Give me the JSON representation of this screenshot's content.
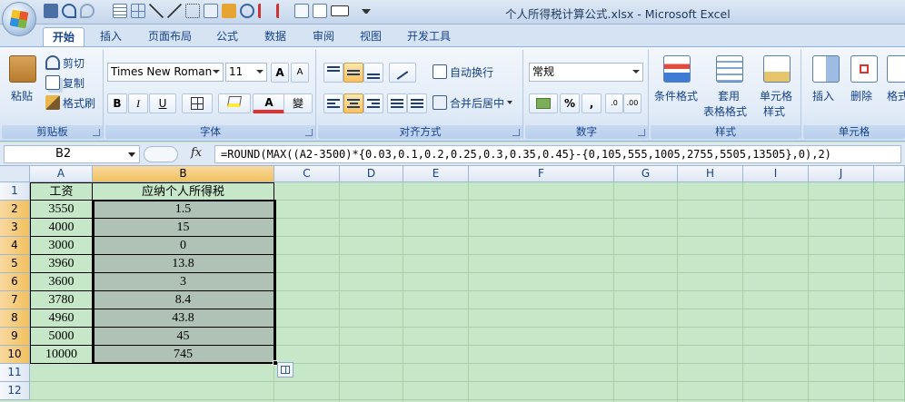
{
  "window": {
    "title": "个人所得税计算公式.xlsx - Microsoft Excel"
  },
  "tabs": [
    "开始",
    "插入",
    "页面布局",
    "公式",
    "数据",
    "审阅",
    "视图",
    "开发工具"
  ],
  "ribbon": {
    "clipboard": {
      "label": "剪贴板",
      "paste": "粘贴",
      "cut": "剪切",
      "copy": "复制",
      "format_painter": "格式刷"
    },
    "font": {
      "label": "字体",
      "name": "Times New Roman",
      "size": "11",
      "bold": "B",
      "italic": "I",
      "underline": "U",
      "wen": "變"
    },
    "alignment": {
      "label": "对齐方式",
      "wrap": "自动换行",
      "merge": "合并后居中"
    },
    "number": {
      "label": "数字",
      "format": "常规",
      "percent": "%",
      "comma": ","
    },
    "styles": {
      "label": "样式",
      "conditional": "条件格式",
      "table_line1": "套用",
      "table_line2": "表格格式",
      "cell_line1": "单元格",
      "cell_line2": "样式"
    },
    "cells": {
      "label": "单元格",
      "insert": "插入",
      "delete": "删除",
      "format": "格式"
    }
  },
  "formula_bar": {
    "name_box": "B2",
    "fx": "fx",
    "formula": "=ROUND(MAX((A2-3500)*{0.03,0.1,0.2,0.25,0.3,0.35,0.45}-{0,105,555,1005,2755,5505,13505},0),2)"
  },
  "sheet": {
    "columns": [
      "A",
      "B",
      "C",
      "D",
      "E",
      "F",
      "G",
      "H",
      "I",
      "J"
    ],
    "rows": [
      "1",
      "2",
      "3",
      "4",
      "5",
      "6",
      "7",
      "8",
      "9",
      "10",
      "11",
      "12"
    ],
    "header": [
      "工资",
      "应纳个人所得税"
    ],
    "data": [
      [
        "3550",
        "1.5"
      ],
      [
        "4000",
        "15"
      ],
      [
        "3000",
        "0"
      ],
      [
        "3960",
        "13.8"
      ],
      [
        "3600",
        "3"
      ],
      [
        "3780",
        "8.4"
      ],
      [
        "4960",
        "43.8"
      ],
      [
        "5000",
        "45"
      ],
      [
        "10000",
        "745"
      ]
    ]
  },
  "colors": {
    "sheet_bg": "#c7e7c9",
    "selection_fill": "#b0c2b5",
    "header_selected": "#f1c15f",
    "ribbon_text": "#15428b"
  }
}
